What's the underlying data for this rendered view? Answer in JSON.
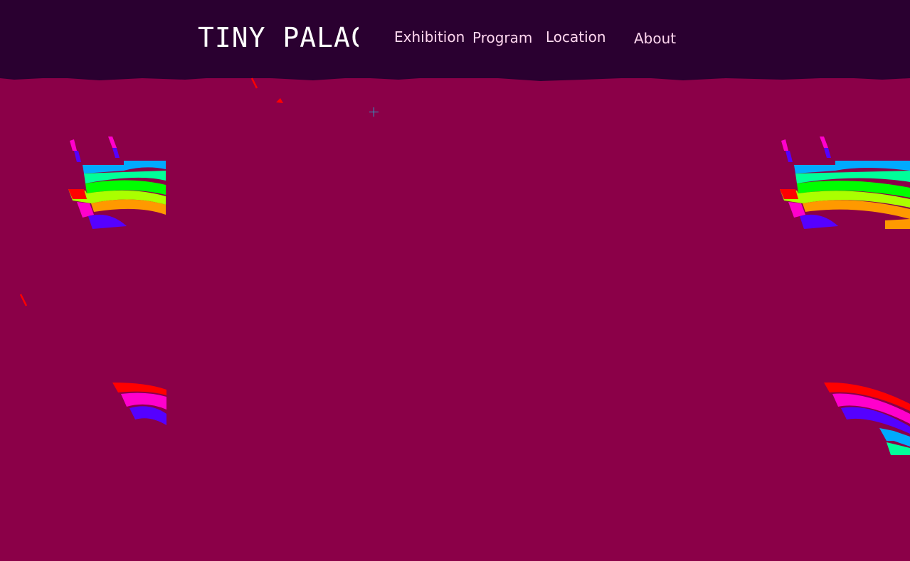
{
  "logo": {
    "text": "TINY PALACE"
  },
  "nav": {
    "exhibition": "Exhibition",
    "program": "Program",
    "location": "Location",
    "about": "About"
  },
  "colors": {
    "header_bg": "#2a0030",
    "page_bg": "#8b0048",
    "nav_text": "#ffd6ef",
    "logo_text": "#ffffff",
    "rainbow": [
      "#ff0000",
      "#ff00cc",
      "#5500ff",
      "#00aaff",
      "#00ff99",
      "#00ff00",
      "#aaff00",
      "#ffcc00",
      "#ff9900"
    ]
  },
  "cursor": {
    "icon": "crosshair-icon"
  }
}
